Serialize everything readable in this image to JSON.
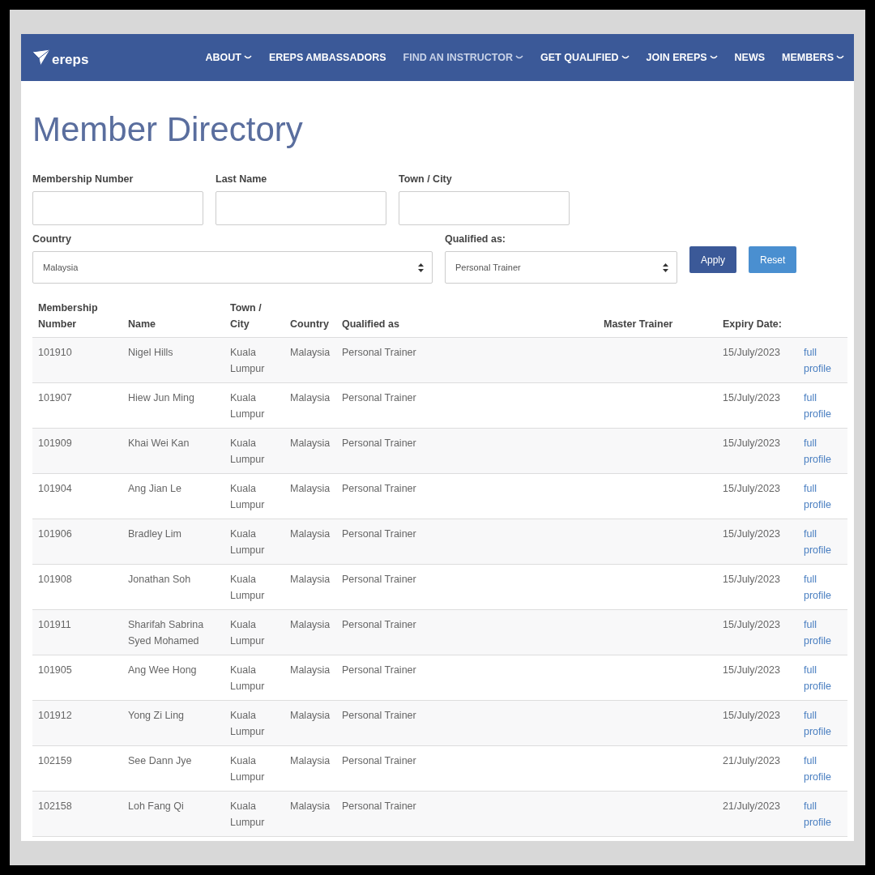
{
  "logo": {
    "text": "ereps"
  },
  "nav": [
    {
      "label": "ABOUT",
      "has_menu": true,
      "selected": false
    },
    {
      "label": "EREPS AMBASSADORS",
      "has_menu": false,
      "selected": false
    },
    {
      "label": "FIND AN INSTRUCTOR",
      "has_menu": true,
      "selected": true
    },
    {
      "label": "GET QUALIFIED",
      "has_menu": true,
      "selected": false
    },
    {
      "label": "JOIN EREPS",
      "has_menu": true,
      "selected": false
    },
    {
      "label": "NEWS",
      "has_menu": false,
      "selected": false
    },
    {
      "label": "MEMBERS",
      "has_menu": true,
      "selected": false
    }
  ],
  "title": "Member Directory",
  "text_fields": [
    {
      "label": "Membership Number"
    },
    {
      "label": "Last Name"
    },
    {
      "label": "Town / City"
    }
  ],
  "selects": [
    {
      "label": "Country",
      "value": "Malaysia",
      "kind": "wide"
    },
    {
      "label": "Qualified as:",
      "value": "Personal Trainer",
      "kind": "narrow"
    }
  ],
  "buttons": [
    {
      "label": "Apply",
      "kind": "primary"
    },
    {
      "label": "Reset",
      "kind": "secondary"
    }
  ],
  "table": {
    "columns": [
      "Membership Number",
      "Name",
      "Town / City",
      "Country",
      "Qualified as",
      "Master Trainer",
      "Expiry Date:"
    ],
    "rows": [
      {
        "number": "101910",
        "name": "Nigel Hills",
        "city": "Kuala Lumpur",
        "country": "Malaysia",
        "qualified": "Personal Trainer",
        "expiry": "15/July/2023",
        "link": "full profile"
      },
      {
        "number": "101907",
        "name": "Hiew Jun Ming",
        "city": "Kuala Lumpur",
        "country": "Malaysia",
        "qualified": "Personal Trainer",
        "expiry": "15/July/2023",
        "link": "full profile"
      },
      {
        "number": "101909",
        "name": "Khai Wei Kan",
        "city": "Kuala Lumpur",
        "country": "Malaysia",
        "qualified": "Personal Trainer",
        "expiry": "15/July/2023",
        "link": "full profile"
      },
      {
        "number": "101904",
        "name": "Ang Jian Le",
        "city": "Kuala Lumpur",
        "country": "Malaysia",
        "qualified": "Personal Trainer",
        "expiry": "15/July/2023",
        "link": "full profile"
      },
      {
        "number": "101906",
        "name": "Bradley Lim",
        "city": "Kuala Lumpur",
        "country": "Malaysia",
        "qualified": "Personal Trainer",
        "expiry": "15/July/2023",
        "link": "full profile"
      },
      {
        "number": "101908",
        "name": "Jonathan Soh",
        "city": "Kuala Lumpur",
        "country": "Malaysia",
        "qualified": "Personal Trainer",
        "expiry": "15/July/2023",
        "link": "full profile"
      },
      {
        "number": "101911",
        "name": "Sharifah Sabrina Syed Mohamed",
        "city": "Kuala Lumpur",
        "country": "Malaysia",
        "qualified": "Personal Trainer",
        "expiry": "15/July/2023",
        "link": "full profile"
      },
      {
        "number": "101905",
        "name": "Ang Wee Hong",
        "city": "Kuala Lumpur",
        "country": "Malaysia",
        "qualified": "Personal Trainer",
        "expiry": "15/July/2023",
        "link": "full profile"
      },
      {
        "number": "101912",
        "name": "Yong Zi Ling",
        "city": "Kuala Lumpur",
        "country": "Malaysia",
        "qualified": "Personal Trainer",
        "expiry": "15/July/2023",
        "link": "full profile"
      },
      {
        "number": "102159",
        "name": "See Dann Jye",
        "city": "Kuala Lumpur",
        "country": "Malaysia",
        "qualified": "Personal Trainer",
        "expiry": "21/July/2023",
        "link": "full profile"
      },
      {
        "number": "102158",
        "name": "Loh Fang Qi",
        "city": "Kuala Lumpur",
        "country": "Malaysia",
        "qualified": "Personal Trainer",
        "expiry": "21/July/2023",
        "link": "full profile"
      }
    ]
  }
}
